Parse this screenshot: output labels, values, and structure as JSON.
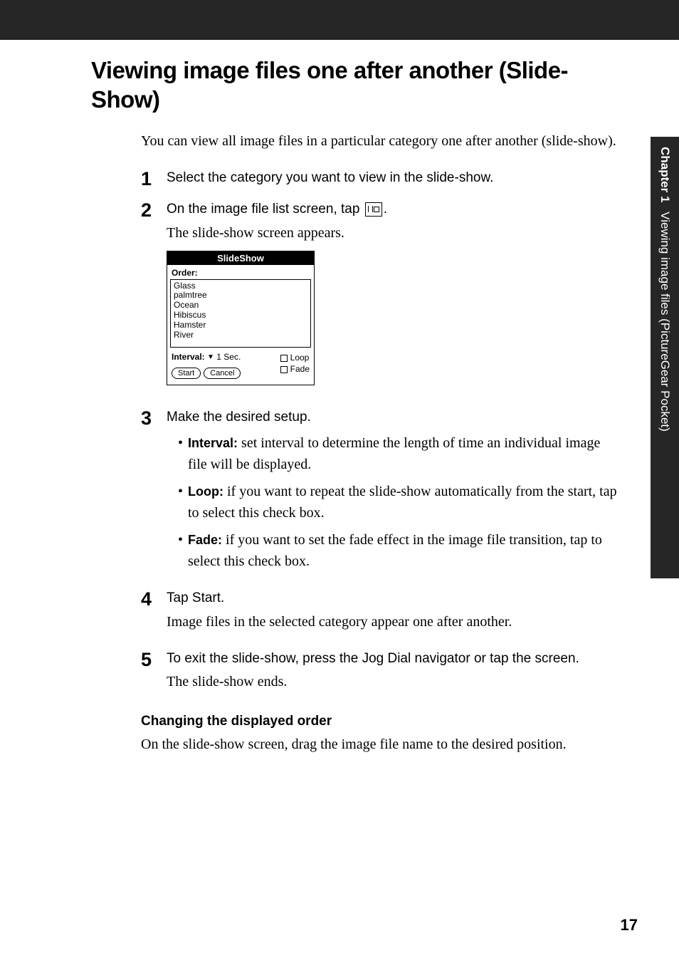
{
  "side_tab": {
    "chapter": "Chapter 1",
    "text": "Viewing image files (PictureGear Pocket)"
  },
  "title": "Viewing image files one after another (Slide-Show)",
  "intro": "You can view all image files in a particular category one after another (slide-show).",
  "steps": {
    "s1": {
      "num": "1",
      "instruction": "Select the category you want to view in the slide-show."
    },
    "s2": {
      "num": "2",
      "instruction_pre": "On the image file list screen, tap ",
      "instruction_post": ".",
      "sub": "The slide-show screen appears."
    },
    "s3": {
      "num": "3",
      "instruction": "Make the desired setup.",
      "bullets": {
        "b1_label": "Interval:",
        "b1_text": " set interval to determine the length of time an individual image file will be displayed.",
        "b2_label": "Loop:",
        "b2_text": " if you want to repeat the slide-show automatically from the start, tap to select this check box.",
        "b3_label": "Fade:",
        "b3_text": " if you want to set the fade effect in the image file transition, tap to select this check box."
      }
    },
    "s4": {
      "num": "4",
      "instruction": "Tap Start.",
      "sub": "Image files in the selected category appear one after another."
    },
    "s5": {
      "num": "5",
      "instruction": "To exit the slide-show, press the Jog Dial navigator or tap the screen.",
      "sub": "The slide-show ends."
    }
  },
  "screenshot": {
    "title": "SlideShow",
    "order_label": "Order:",
    "items": [
      "Glass",
      "palmtree",
      "Ocean",
      "Hibiscus",
      "Hamster",
      "River"
    ],
    "interval_label": "Interval:",
    "interval_value": "1 Sec.",
    "loop_label": "Loop",
    "fade_label": "Fade",
    "start_btn": "Start",
    "cancel_btn": "Cancel"
  },
  "section2": {
    "heading": "Changing the displayed order",
    "text": "On the slide-show screen, drag the image file name to the desired position."
  },
  "page_number": "17"
}
